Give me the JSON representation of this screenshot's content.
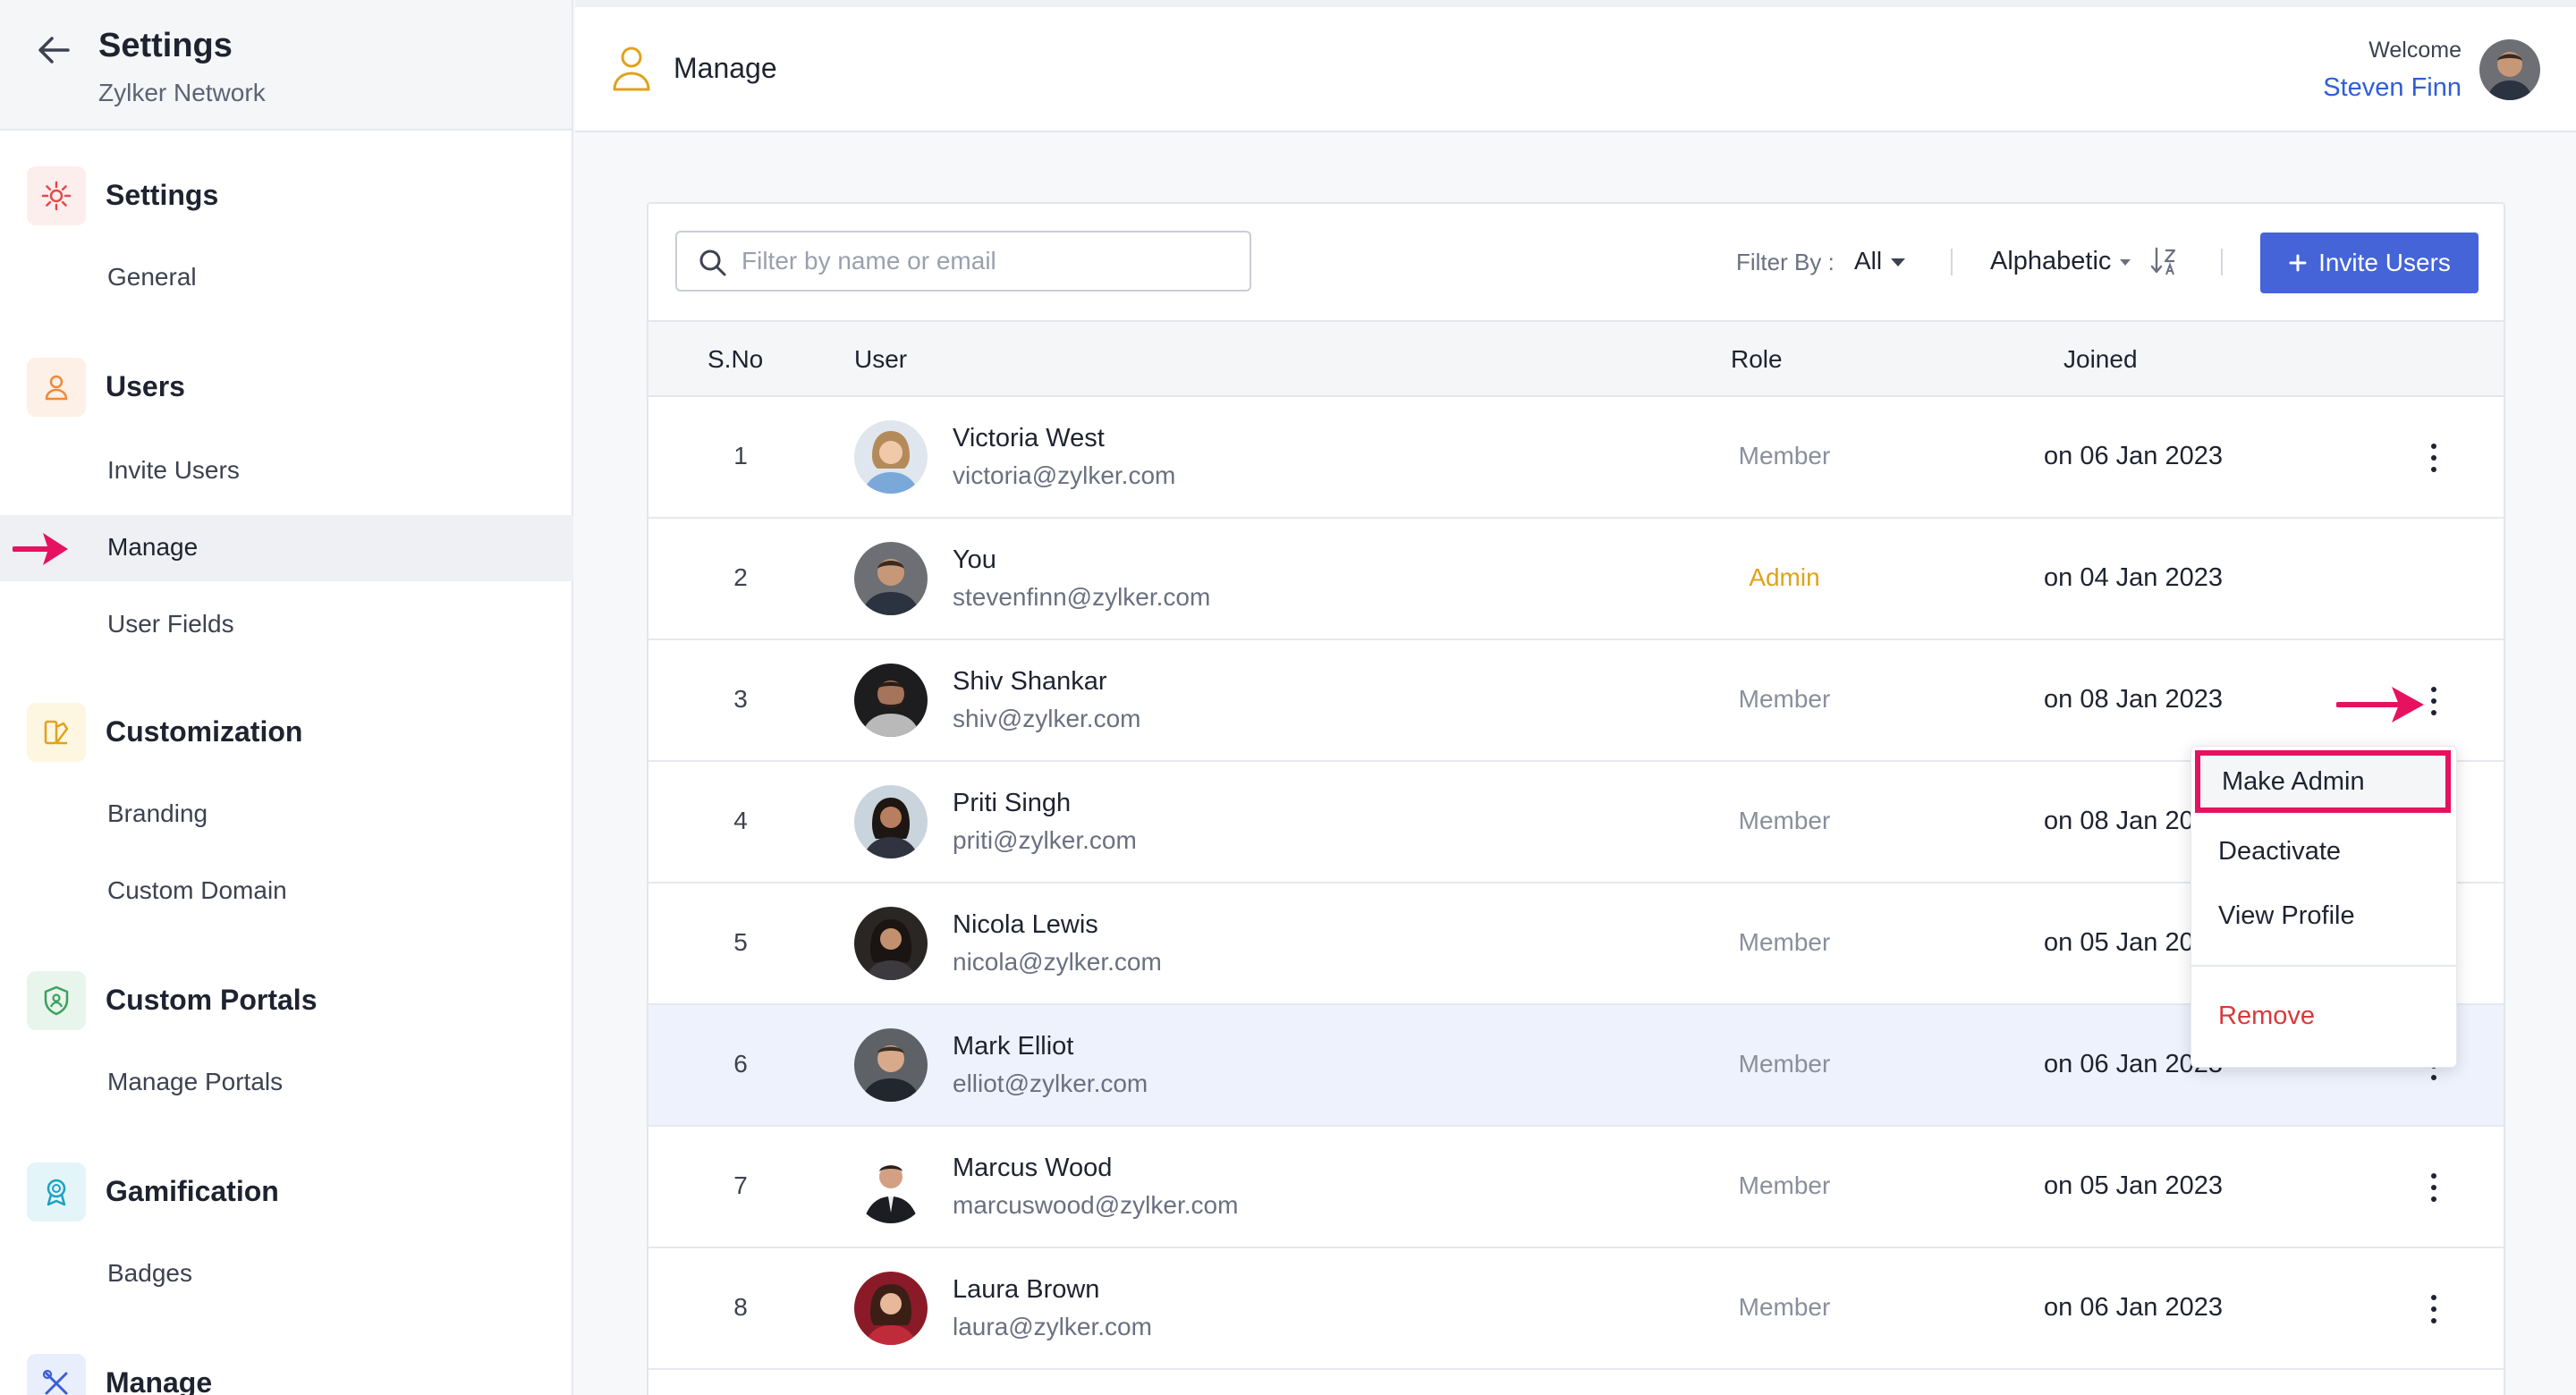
{
  "sidebar": {
    "title": "Settings",
    "subtitle": "Zylker Network",
    "groups": [
      {
        "label": "Settings",
        "icon": "gear-icon",
        "color": "#e24a4a",
        "bg": "#fdeeee"
      },
      {
        "label": "Users",
        "icon": "user-icon",
        "color": "#ec8a3c",
        "bg": "#fdf0e6"
      },
      {
        "label": "Customization",
        "icon": "customization-icon",
        "color": "#e0a21a",
        "bg": "#fdf6e1"
      },
      {
        "label": "Custom Portals",
        "icon": "portal-shield-icon",
        "color": "#3aa15e",
        "bg": "#e8f5ec"
      },
      {
        "label": "Gamification",
        "icon": "badge-icon",
        "color": "#1aa1c2",
        "bg": "#e4f5f9"
      },
      {
        "label": "Manage",
        "icon": "tools-icon",
        "color": "#3b5fd6",
        "bg": "#e9eefc"
      }
    ],
    "items": [
      {
        "label": "General"
      },
      {
        "label": "Invite Users"
      },
      {
        "label": "Manage"
      },
      {
        "label": "User Fields"
      },
      {
        "label": "Branding"
      },
      {
        "label": "Custom Domain"
      },
      {
        "label": "Manage Portals"
      },
      {
        "label": "Badges"
      }
    ]
  },
  "topbar": {
    "title": "Manage",
    "welcome": "Welcome",
    "user_name": "Steven Finn"
  },
  "toolbar": {
    "search_placeholder": "Filter by name or email",
    "filter_label": "Filter By :",
    "filter_value": "All",
    "sort_value": "Alphabetic",
    "invite_label": "Invite Users"
  },
  "table": {
    "headers": {
      "sno": "S.No",
      "user": "User",
      "role": "Role",
      "joined": "Joined"
    },
    "rows": [
      {
        "sno": "1",
        "name": "Victoria West",
        "email": "victoria@zylker.com",
        "role": "Member",
        "joined": "on 06 Jan 2023"
      },
      {
        "sno": "2",
        "name": "You",
        "email": "stevenfinn@zylker.com",
        "role": "Admin",
        "joined": "on 04 Jan 2023"
      },
      {
        "sno": "3",
        "name": "Shiv Shankar",
        "email": "shiv@zylker.com",
        "role": "Member",
        "joined": "on 08 Jan 2023"
      },
      {
        "sno": "4",
        "name": "Priti Singh",
        "email": "priti@zylker.com",
        "role": "Member",
        "joined": "on 08 Jan 2023"
      },
      {
        "sno": "5",
        "name": "Nicola Lewis",
        "email": "nicola@zylker.com",
        "role": "Member",
        "joined": "on 05 Jan 2023"
      },
      {
        "sno": "6",
        "name": "Mark Elliot",
        "email": "elliot@zylker.com",
        "role": "Member",
        "joined": "on 06 Jan 2023"
      },
      {
        "sno": "7",
        "name": "Marcus Wood",
        "email": "marcuswood@zylker.com",
        "role": "Member",
        "joined": "on 05 Jan 2023"
      },
      {
        "sno": "8",
        "name": "Laura Brown",
        "email": "laura@zylker.com",
        "role": "Member",
        "joined": "on 06 Jan 2023"
      }
    ]
  },
  "menu": {
    "items": [
      "Make Admin",
      "Deactivate",
      "View Profile"
    ],
    "remove": "Remove"
  },
  "colors": {
    "accent": "#4564d8",
    "highlight": "#e6125f",
    "admin": "#e0a21a",
    "danger": "#d93939"
  }
}
